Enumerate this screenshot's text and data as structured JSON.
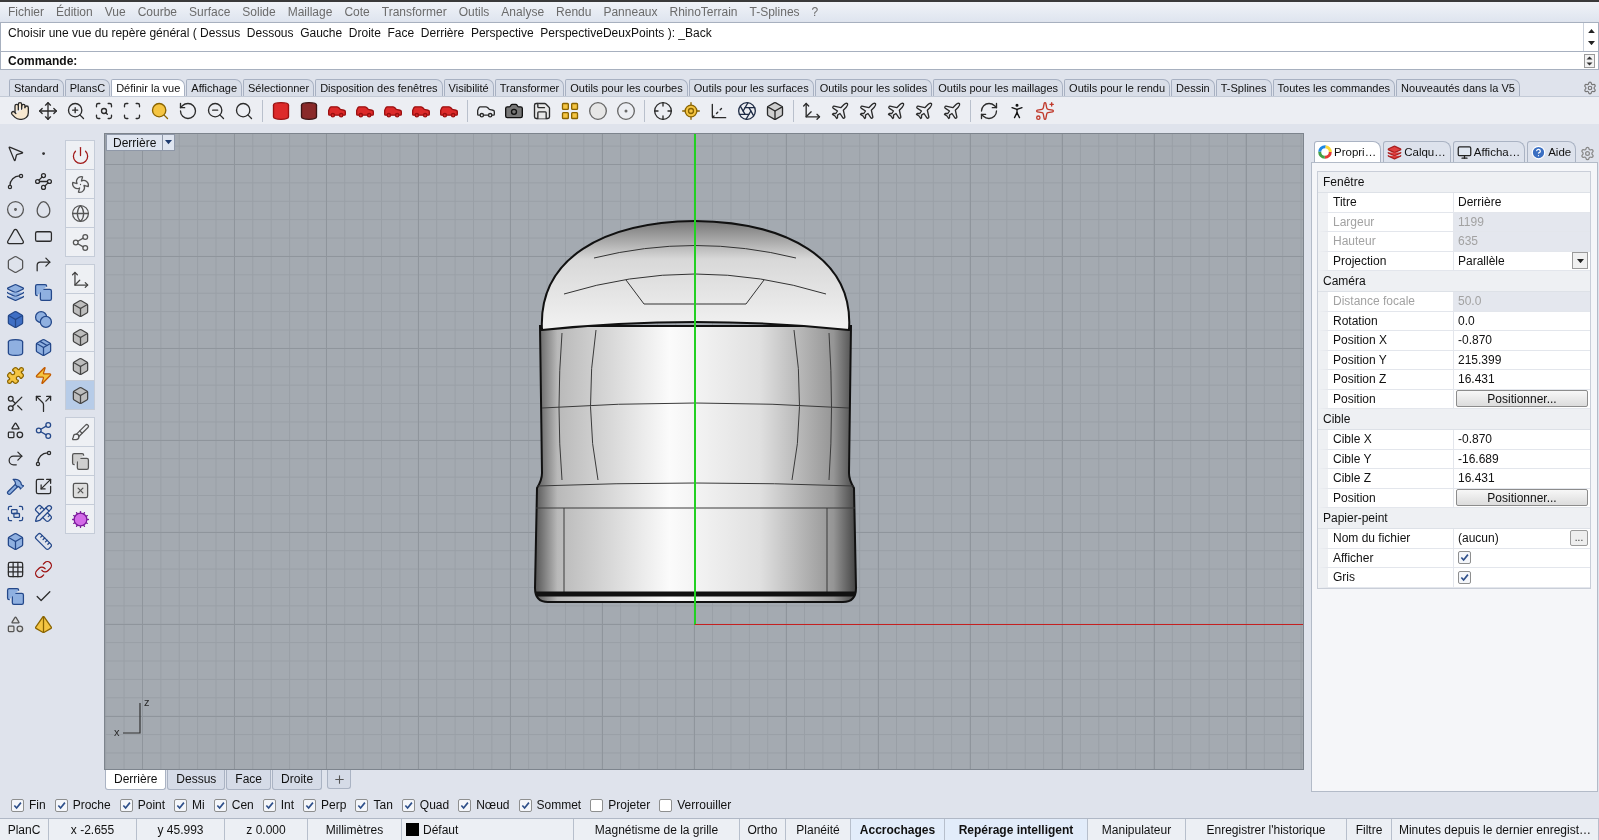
{
  "menu_bar": {
    "items": [
      "Fichier",
      "Édition",
      "Vue",
      "Courbe",
      "Surface",
      "Solide",
      "Maillage",
      "Cote",
      "Transformer",
      "Outils",
      "Analyse",
      "Rendu",
      "Panneaux",
      "RhinoTerrain",
      "T-Splines",
      "?"
    ]
  },
  "command_history": {
    "text": "Choisir une vue du repère général ( Dessus  Dessous  Gauche  Droite  Face  Derrière  Perspective  PerspectiveDeuxPoints ): _Back"
  },
  "command_line": {
    "prompt": "Commande:"
  },
  "toolbar_tabs": [
    {
      "label": "Standard",
      "selected": false
    },
    {
      "label": "PlansC",
      "selected": false
    },
    {
      "label": "Définir la vue",
      "selected": true
    },
    {
      "label": "Affichage",
      "selected": false
    },
    {
      "label": "Sélectionner",
      "selected": false
    },
    {
      "label": "Disposition des fenêtres",
      "selected": false
    },
    {
      "label": "Visibilité",
      "selected": false
    },
    {
      "label": "Transformer",
      "selected": false
    },
    {
      "label": "Outils pour les courbes",
      "selected": false
    },
    {
      "label": "Outils pour les surfaces",
      "selected": false
    },
    {
      "label": "Outils pour les solides",
      "selected": false
    },
    {
      "label": "Outils pour les maillages",
      "selected": false
    },
    {
      "label": "Outils pour le rendu",
      "selected": false
    },
    {
      "label": "Dessin",
      "selected": false
    },
    {
      "label": "T-Splines",
      "selected": false
    },
    {
      "label": "Toutes les commandes",
      "selected": false
    },
    {
      "label": "Nouveautés dans la V5",
      "selected": false
    }
  ],
  "side_toolbar": [
    {
      "selected": false
    },
    {
      "selected": false
    },
    {
      "selected": false
    },
    {
      "selected": false
    },
    {
      "selected": false
    },
    {
      "selected": false
    },
    {
      "selected": false
    },
    {
      "selected": false
    },
    {
      "selected": true
    },
    {
      "selected": false
    },
    {
      "selected": false
    },
    {
      "selected": false
    },
    {
      "selected": false
    }
  ],
  "viewport": {
    "title": "Derrière",
    "axis_labels": {
      "vertical": "z",
      "horizontal": "x"
    }
  },
  "viewport_tabs": [
    {
      "label": "Derrière",
      "selected": true
    },
    {
      "label": "Dessus",
      "selected": false
    },
    {
      "label": "Face",
      "selected": false
    },
    {
      "label": "Droite",
      "selected": false
    }
  ],
  "properties_panel": {
    "tabs": [
      {
        "label": "Propri…",
        "selected": true
      },
      {
        "label": "Calqu…",
        "selected": false
      },
      {
        "label": "Afficha…",
        "selected": false
      },
      {
        "label": "Aide",
        "selected": false
      }
    ],
    "sections": [
      {
        "title": "Fenêtre",
        "rows": [
          {
            "label": "Titre",
            "kind": "text",
            "value": "Derrière",
            "disabled": false
          },
          {
            "label": "Largeur",
            "kind": "text",
            "value": "1199",
            "disabled": true
          },
          {
            "label": "Hauteur",
            "kind": "text",
            "value": "635",
            "disabled": true
          },
          {
            "label": "Projection",
            "kind": "dropdown",
            "value": "Parallèle",
            "disabled": false
          }
        ]
      },
      {
        "title": "Caméra",
        "rows": [
          {
            "label": "Distance focale",
            "kind": "text",
            "value": "50.0",
            "disabled": true
          },
          {
            "label": "Rotation",
            "kind": "text",
            "value": "0.0",
            "disabled": false
          },
          {
            "label": "Position X",
            "kind": "text",
            "value": "-0.870",
            "disabled": false
          },
          {
            "label": "Position Y",
            "kind": "text",
            "value": "215.399",
            "disabled": false
          },
          {
            "label": "Position Z",
            "kind": "text",
            "value": "16.431",
            "disabled": false
          },
          {
            "label": "Position",
            "kind": "button",
            "value": "Positionner...",
            "disabled": false
          }
        ]
      },
      {
        "title": "Cible",
        "rows": [
          {
            "label": "Cible X",
            "kind": "text",
            "value": "-0.870",
            "disabled": false
          },
          {
            "label": "Cible Y",
            "kind": "text",
            "value": "-16.689",
            "disabled": false
          },
          {
            "label": "Cible Z",
            "kind": "text",
            "value": "16.431",
            "disabled": false
          },
          {
            "label": "Position",
            "kind": "button",
            "value": "Positionner...",
            "disabled": false
          }
        ]
      },
      {
        "title": "Papier-peint",
        "rows": [
          {
            "label": "Nom du fichier",
            "kind": "file",
            "value": "(aucun)",
            "button": "...",
            "disabled": false
          },
          {
            "label": "Afficher",
            "kind": "checkbox",
            "checked": true,
            "disabled": false
          },
          {
            "label": "Gris",
            "kind": "checkbox",
            "checked": true,
            "disabled": false
          }
        ]
      }
    ]
  },
  "osnaps": [
    {
      "label": "Fin",
      "checked": true
    },
    {
      "label": "Proche",
      "checked": true
    },
    {
      "label": "Point",
      "checked": true
    },
    {
      "label": "Mi",
      "checked": true
    },
    {
      "label": "Cen",
      "checked": true
    },
    {
      "label": "Int",
      "checked": true
    },
    {
      "label": "Perp",
      "checked": true
    },
    {
      "label": "Tan",
      "checked": true
    },
    {
      "label": "Quad",
      "checked": true
    },
    {
      "label": "Nœud",
      "checked": true
    },
    {
      "label": "Sommet",
      "checked": true
    },
    {
      "label": "Projeter",
      "checked": false
    },
    {
      "label": "Verrouiller",
      "checked": false
    }
  ],
  "status_bar": {
    "items": [
      {
        "text": "PlanC",
        "kind": "text"
      },
      {
        "text": "x -2.655",
        "kind": "text"
      },
      {
        "text": "y 45.993",
        "kind": "text"
      },
      {
        "text": "z 0.000",
        "kind": "text"
      },
      {
        "text": "Millimètres",
        "kind": "text"
      },
      {
        "text": "Défaut",
        "kind": "layer",
        "color": "#000000"
      },
      {
        "text": "Magnétisme de la grille",
        "kind": "toggle",
        "on": false
      },
      {
        "text": "Ortho",
        "kind": "toggle",
        "on": false
      },
      {
        "text": "Planéité",
        "kind": "toggle",
        "on": false
      },
      {
        "text": "Accrochages",
        "kind": "toggle",
        "on": true
      },
      {
        "text": "Repérage intelligent",
        "kind": "toggle",
        "on": true
      },
      {
        "text": "Manipulateur",
        "kind": "toggle",
        "on": false
      },
      {
        "text": "Enregistrer l'historique",
        "kind": "toggle",
        "on": false
      },
      {
        "text": "Filtre",
        "kind": "toggle",
        "on": false
      },
      {
        "text": "Minutes depuis le dernier enregist…",
        "kind": "text"
      }
    ]
  }
}
